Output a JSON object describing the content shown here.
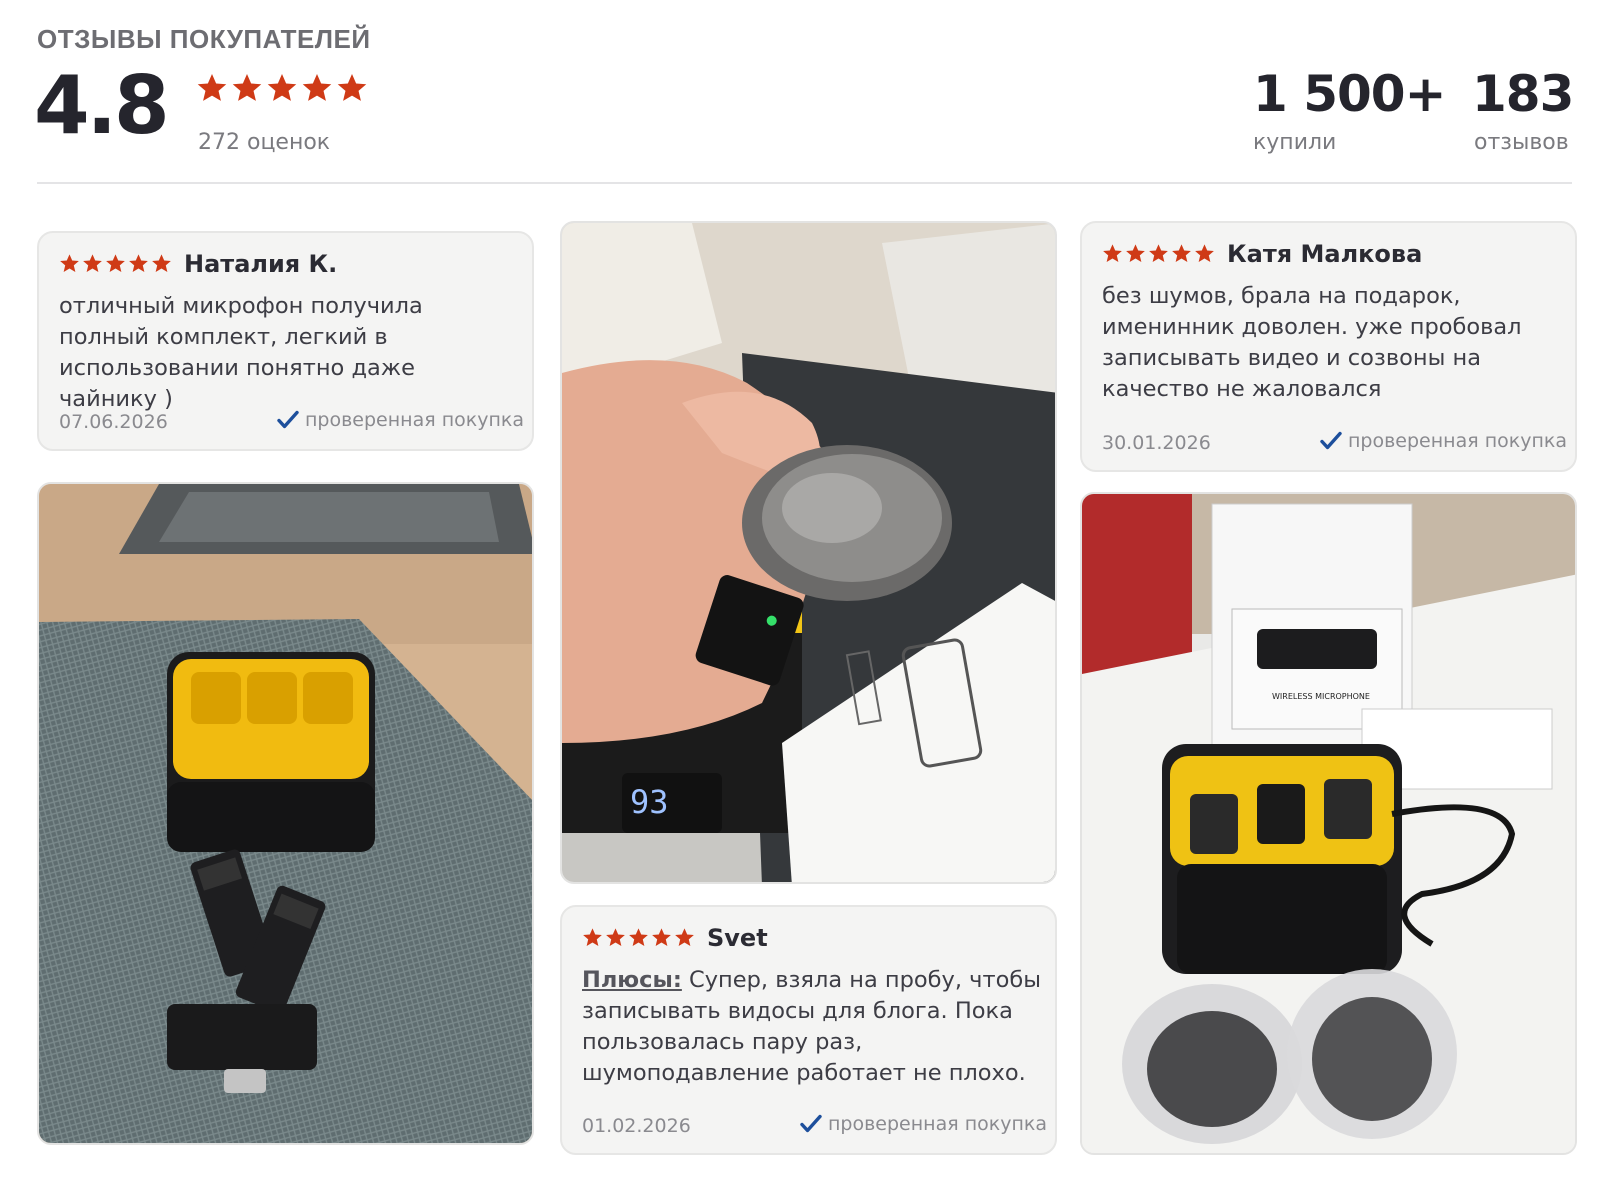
{
  "header": {
    "title": "ОТЗЫВЫ ПОКУПАТЕЛЕЙ",
    "rating": "4.8",
    "rating_count": "272 оценок",
    "bought_value": "1 500+",
    "bought_label": "купили",
    "reviews_value": "183",
    "reviews_label": "отзывов"
  },
  "colors": {
    "star": "#cf3a16",
    "check": "#1d4f9c",
    "card_bg": "#f4f4f3"
  },
  "reviews": [
    {
      "author": "Наталия К.",
      "stars": 5,
      "text": "отличный микрофон получила полный комплект, легкий в использовании понятно даже чайнику )",
      "date": "07.06.2026",
      "verified": "проверенная покупка"
    },
    {
      "author": "Svet",
      "stars": 5,
      "pros_label": "Плюсы:",
      "text": " Супер, взяла на пробу, чтобы записывать видосы для блога. Пока пользовалась пару раз, шумоподавление работает не плохо.",
      "date": "01.02.2026",
      "verified": "проверенная покупка"
    },
    {
      "author": "Катя Малкова",
      "stars": 5,
      "text": "без шумов, брала на подарок, именинник доволен. уже пробовал записывать видео и созвоны на качество не жаловался",
      "date": "30.01.2026",
      "verified": "проверенная покупка"
    }
  ],
  "photos": {
    "photo1": {
      "display_digits": "93",
      "screen_label": "WIRELESS MICROPHONE"
    }
  },
  "icons": [
    "star-icon",
    "check-icon"
  ]
}
